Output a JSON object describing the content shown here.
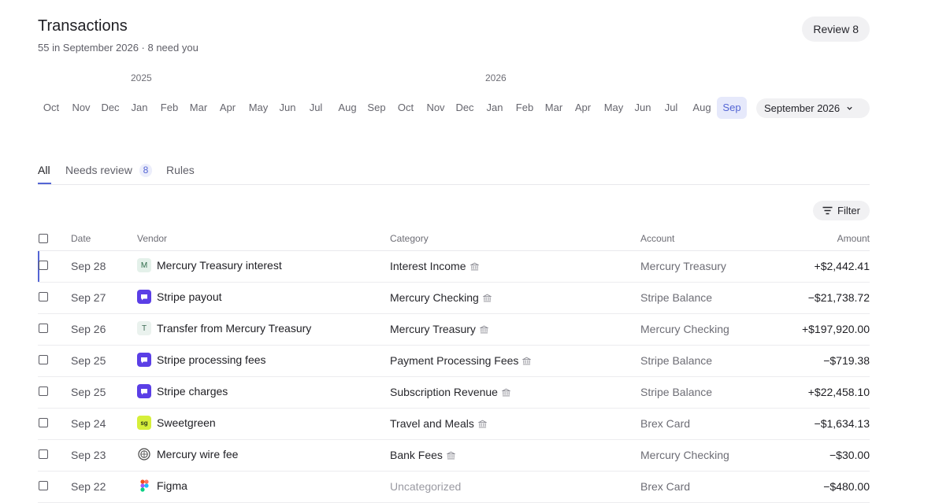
{
  "header": {
    "title": "Transactions",
    "subtitle": "55 in September 2026 · 8 need you",
    "review_label": "Review 8"
  },
  "timeline": {
    "years": [
      "2025",
      "2026"
    ],
    "months": [
      "Oct",
      "Nov",
      "Dec",
      "Jan",
      "Feb",
      "Mar",
      "Apr",
      "May",
      "Jun",
      "Jul",
      "Aug",
      "Sep",
      "Oct",
      "Nov",
      "Dec",
      "Jan",
      "Feb",
      "Mar",
      "Apr",
      "May",
      "Jun",
      "Jul",
      "Aug",
      "Sep"
    ],
    "selected_month": "Sep",
    "picker_label": "September 2026"
  },
  "tabs": {
    "all": "All",
    "needs_review": "Needs review",
    "needs_review_count": "8",
    "rules": "Rules"
  },
  "filter_label": "Filter",
  "table": {
    "columns": {
      "date": "Date",
      "vendor": "Vendor",
      "category": "Category",
      "account": "Account",
      "amount": "Amount"
    },
    "rows": [
      {
        "date": "Sep 28",
        "vendor": "Mercury Treasury interest",
        "icon": "M",
        "icon_name": "mercury-m-icon",
        "category": "Interest Income",
        "account": "Mercury Treasury",
        "amount": "+$2,442.41"
      },
      {
        "date": "Sep 27",
        "vendor": "Stripe payout",
        "icon": "",
        "icon_name": "stripe-icon",
        "category": "Mercury Checking",
        "account": "Stripe Balance",
        "amount": "−$21,738.72"
      },
      {
        "date": "Sep 26",
        "vendor": "Transfer from Mercury Treasury",
        "icon": "T",
        "icon_name": "transfer-t-icon",
        "category": "Mercury Treasury",
        "account": "Mercury Checking",
        "amount": "+$197,920.00"
      },
      {
        "date": "Sep 25",
        "vendor": "Stripe processing fees",
        "icon": "",
        "icon_name": "stripe-icon",
        "category": "Payment Processing Fees",
        "account": "Stripe Balance",
        "amount": "−$719.38"
      },
      {
        "date": "Sep 25",
        "vendor": "Stripe charges",
        "icon": "",
        "icon_name": "stripe-icon",
        "category": "Subscription Revenue",
        "account": "Stripe Balance",
        "amount": "+$22,458.10"
      },
      {
        "date": "Sep 24",
        "vendor": "Sweetgreen",
        "icon": "sg",
        "icon_name": "sweetgreen-icon",
        "category": "Travel and Meals",
        "account": "Brex Card",
        "amount": "−$1,634.13"
      },
      {
        "date": "Sep 23",
        "vendor": "Mercury wire fee",
        "icon": "",
        "icon_name": "mercury-logo-icon",
        "category": "Bank Fees",
        "account": "Mercury Checking",
        "amount": "−$30.00"
      },
      {
        "date": "Sep 22",
        "vendor": "Figma",
        "icon": "",
        "icon_name": "figma-icon",
        "category": "Uncategorized",
        "account": "Brex Card",
        "amount": "−$480.00"
      }
    ]
  },
  "colors": {
    "accent": "#5465d4",
    "stripe": "#5b3fe6",
    "sweetgreen": "#d6ef3a"
  }
}
